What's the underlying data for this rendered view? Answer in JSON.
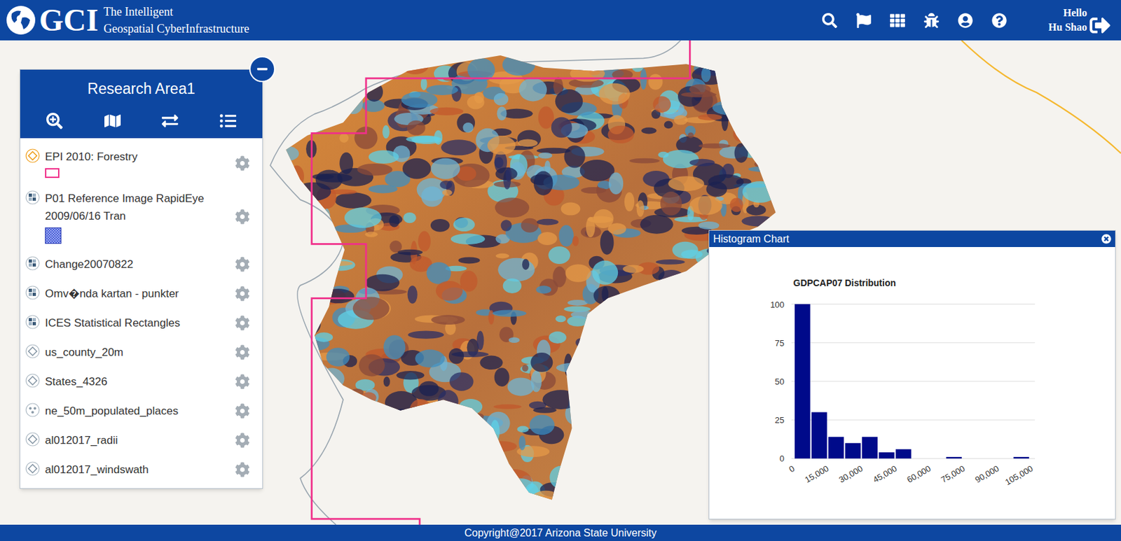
{
  "header": {
    "logo": "GCI",
    "tagline": [
      "The Intelligent",
      "Geospatial CyberInfrastructure"
    ],
    "greeting": "Hello",
    "user": "Hu Shao"
  },
  "panel": {
    "title": "Research Area1"
  },
  "layers": [
    {
      "name": "EPI 2010: Forestry",
      "kind": "polygon",
      "active": true,
      "legend": "outline"
    },
    {
      "name": "P01 Reference Image RapidEye 2009/06/16 Tran",
      "kind": "raster",
      "active": false,
      "legend": "pattern"
    },
    {
      "name": "Change20070822",
      "kind": "raster",
      "active": false,
      "legend": "none"
    },
    {
      "name": "Omv�nda kartan - punkter",
      "kind": "raster",
      "active": false,
      "legend": "none"
    },
    {
      "name": "ICES Statistical Rectangles",
      "kind": "raster",
      "active": false,
      "legend": "none"
    },
    {
      "name": "us_county_20m",
      "kind": "polygon",
      "active": false,
      "legend": "none"
    },
    {
      "name": "States_4326",
      "kind": "polygon",
      "active": false,
      "legend": "none"
    },
    {
      "name": "ne_50m_populated_places",
      "kind": "point",
      "active": false,
      "legend": "none"
    },
    {
      "name": "al012017_radii",
      "kind": "polygon",
      "active": false,
      "legend": "none"
    },
    {
      "name": "al012017_windswath",
      "kind": "polygon",
      "active": false,
      "legend": "none"
    }
  ],
  "histogram": {
    "title": "Histogram Chart",
    "chart_title": "GDPCAP07 Distribution",
    "y_ticks": [
      "0",
      "25",
      "50",
      "75",
      "100"
    ],
    "x_ticks": [
      "0",
      "15,000",
      "30,000",
      "45,000",
      "60,000",
      "75,000",
      "90,000",
      "105,000"
    ],
    "y_max": 100,
    "x_max": 105000,
    "bin_width": 7500,
    "values": [
      100,
      30,
      14,
      10,
      14,
      4,
      6,
      0,
      0,
      1,
      0,
      0,
      0,
      1
    ]
  },
  "footer": "Copyright@2017 Arizona State University"
}
